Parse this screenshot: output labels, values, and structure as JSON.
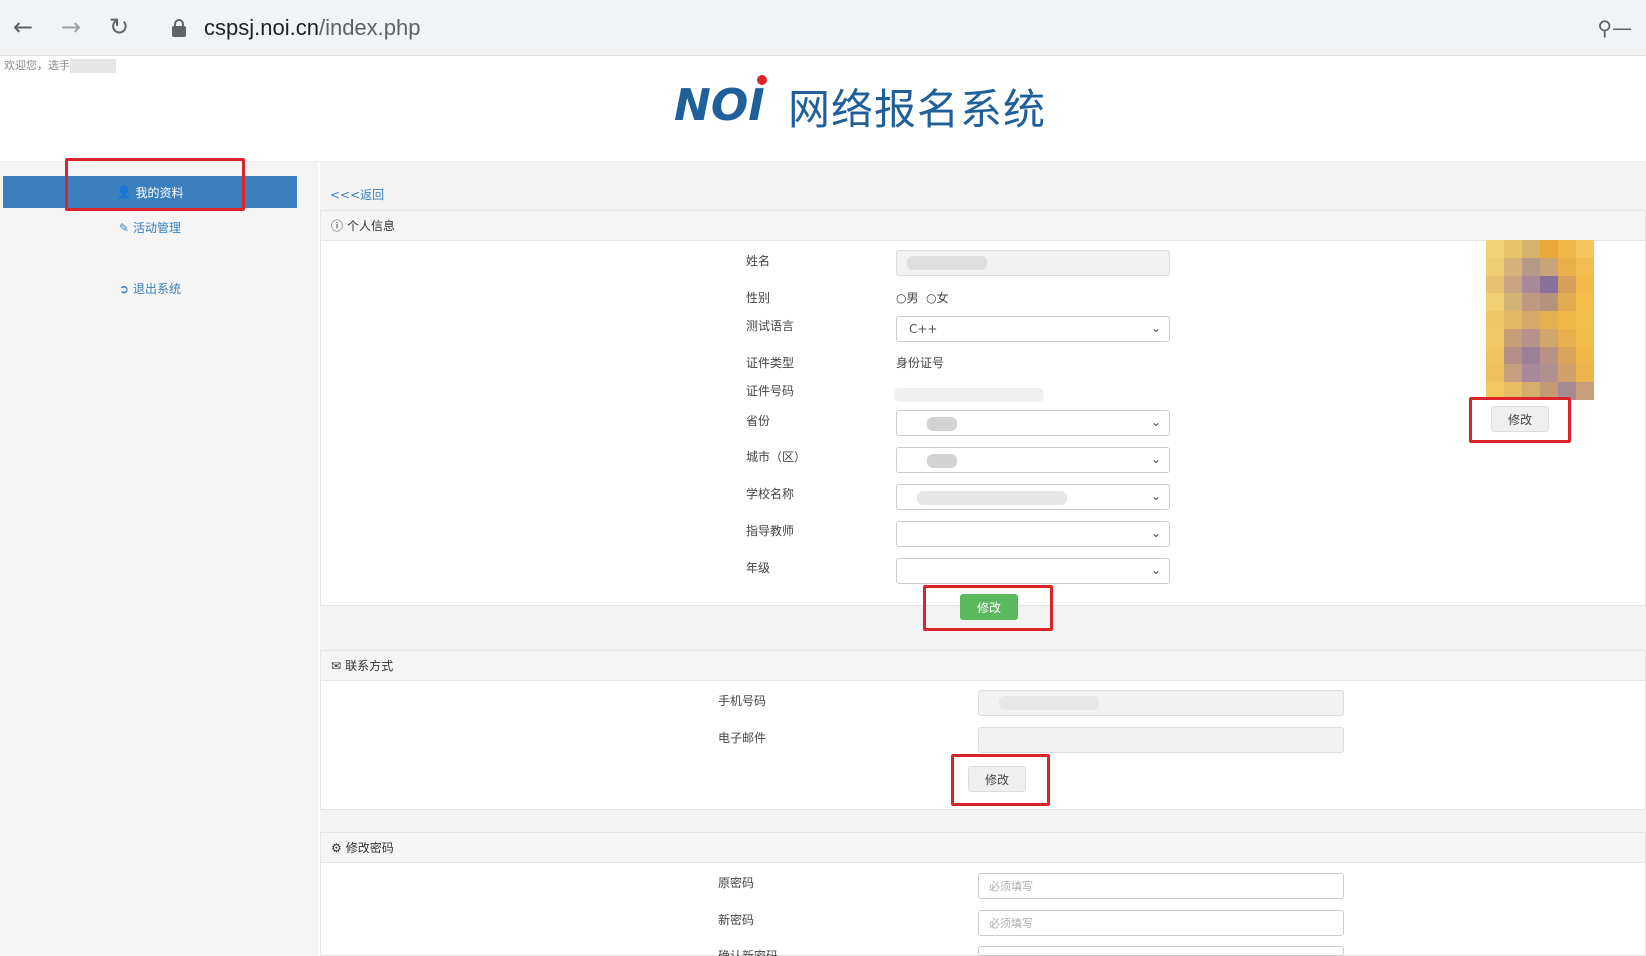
{
  "browser": {
    "url_host": "cspsj.noi.cn",
    "url_path": "/index.php"
  },
  "welcome": "欢迎您，选手",
  "header": {
    "logo_text": "NOI",
    "title": "网络报名系统"
  },
  "sidebar": {
    "items": [
      {
        "label": "我的资料",
        "icon": "user-icon",
        "active": true
      },
      {
        "label": "活动管理",
        "icon": "edit-icon",
        "active": false
      },
      {
        "label": "退出系统",
        "icon": "logout-icon",
        "active": false
      }
    ]
  },
  "main": {
    "back_link": "<<<返回",
    "personal": {
      "title": "个人信息",
      "fields": {
        "name_label": "姓名",
        "gender_label": "性别",
        "gender_male": "男",
        "gender_female": "女",
        "lang_label": "测试语言",
        "lang_value": "C++",
        "id_type_label": "证件类型",
        "id_type_value": "身份证号",
        "id_number_label": "证件号码",
        "province_label": "省份",
        "city_label": "城市（区）",
        "school_label": "学校名称",
        "teacher_label": "指导教师",
        "grade_label": "年级"
      },
      "submit_label": "修改",
      "photo_button_label": "修改"
    },
    "contact": {
      "title": "联系方式",
      "phone_label": "手机号码",
      "email_label": "电子邮件",
      "submit_label": "修改"
    },
    "password": {
      "title": "修改密码",
      "old_label": "原密码",
      "new_label": "新密码",
      "confirm_label": "确认新密码",
      "placeholder": "必须填写"
    }
  },
  "colors": {
    "accent": "#3a7fbe",
    "highlight": "#d9252a",
    "success": "#5cb85c"
  }
}
